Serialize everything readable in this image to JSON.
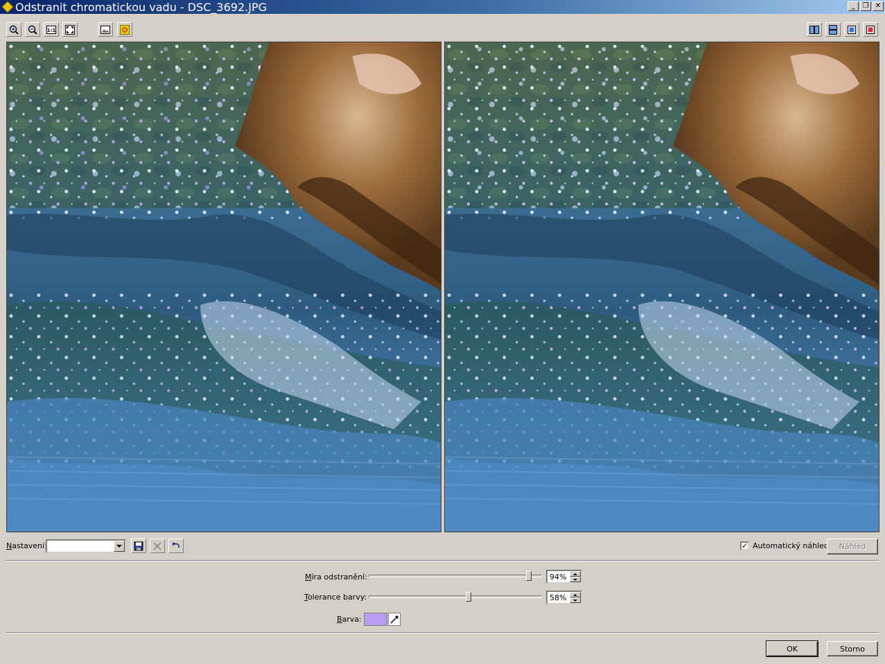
{
  "window": {
    "title": "Odstranit chromatickou vadu - DSC_3692.JPG",
    "minimize": "_",
    "maximize": "❐",
    "close": "✕"
  },
  "toolbar": {
    "left_icons": [
      "zoom-in-icon",
      "zoom-out-icon",
      "actual-size-icon",
      "fit-to-window-icon",
      "original-image-icon",
      "highlight-icon"
    ],
    "right_icons": [
      "split-vertical-icon",
      "split-horizontal-icon",
      "single-view-icon",
      "compare-view-icon"
    ]
  },
  "settings": {
    "label_prefix": "N",
    "label_rest": "astavení:",
    "combo_value": "",
    "icons": [
      "save-icon",
      "delete-icon",
      "undo-icon"
    ]
  },
  "preview": {
    "auto_label": "Automatický náhled",
    "auto_checked": true,
    "button": "Náhled"
  },
  "controls": {
    "removal": {
      "label_u": "M",
      "label_rest": "íra odstranění:",
      "value": "94%",
      "fraction": 0.94
    },
    "tolerance": {
      "label_u": "T",
      "label_rest": "olerance barvy:",
      "value": "58%",
      "fraction": 0.58
    },
    "color": {
      "label_u": "B",
      "label_rest": "arva:",
      "swatch": "#b89cf0"
    }
  },
  "buttons": {
    "ok": "OK",
    "cancel": "Storno"
  },
  "colors": {
    "face": "#d4d0c8",
    "title_start": "#0a246a",
    "title_end": "#a6caf0"
  }
}
